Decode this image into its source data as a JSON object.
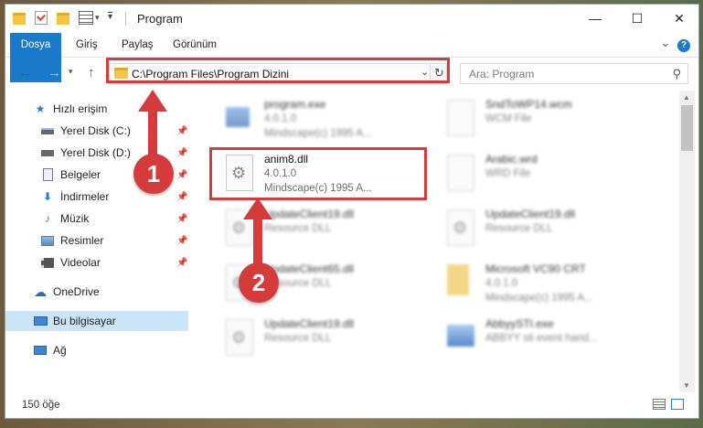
{
  "window": {
    "title": "Program",
    "controls": {
      "minimize": "—",
      "maximize": "☐",
      "close": "✕"
    }
  },
  "ribbon": {
    "tabs": [
      "Dosya",
      "Giriş",
      "Paylaş",
      "Görünüm"
    ],
    "expand": "⌄",
    "help": "?"
  },
  "nav": {
    "address": "C:\\Program Files\\Program Dizini",
    "search_placeholder": "Ara: Program"
  },
  "sidebar": {
    "items": [
      {
        "label": "Hızlı erişim",
        "icon": "star-icon"
      },
      {
        "label": "Yerel Disk (C:)",
        "icon": "drive-icon"
      },
      {
        "label": "Yerel Disk (D:)",
        "icon": "drive-icon"
      },
      {
        "label": "Belgeler",
        "icon": "documents-icon"
      },
      {
        "label": "İndirmeler",
        "icon": "download-icon"
      },
      {
        "label": "Müzik",
        "icon": "music-icon"
      },
      {
        "label": "Resimler",
        "icon": "pictures-icon"
      },
      {
        "label": "Videolar",
        "icon": "video-icon"
      },
      {
        "label": "OneDrive",
        "icon": "cloud-icon"
      },
      {
        "label": "Bu bilgisayar",
        "icon": "computer-icon"
      },
      {
        "label": "Ağ",
        "icon": "network-icon"
      }
    ]
  },
  "files": [
    {
      "name": "program.exe",
      "l2": "4.0.1.0",
      "l3": "Mindscape(c) 1995 A..."
    },
    {
      "name": "SndToWP14.wcm",
      "l2": "WCM File",
      "l3": ""
    },
    {
      "name": "anim8.dll",
      "l2": "4.0.1.0",
      "l3": "Mindscape(c) 1995 A..."
    },
    {
      "name": "Arabic.wrd",
      "l2": "WRD File",
      "l3": ""
    },
    {
      "name": "UpdateClient19.dll",
      "l2": "Resource DLL",
      "l3": ""
    },
    {
      "name": "UpdateClient19.dll",
      "l2": "Resource DLL",
      "l3": ""
    },
    {
      "name": "UpdateClient65.dll",
      "l2": "Resource DLL",
      "l3": ""
    },
    {
      "name": "Microsoft VC90 CRT",
      "l2": "4.0.1.0",
      "l3": "Mindscape(c) 1995 A..."
    },
    {
      "name": "UpdateClient19.dll",
      "l2": "Resource DLL",
      "l3": ""
    },
    {
      "name": "AbbyySTI.exe",
      "l2": "ABBYY sti event hand...",
      "l3": ""
    }
  ],
  "status": {
    "count": "150 öğe"
  },
  "annotations": {
    "badge1": "1",
    "badge2": "2",
    "color": "#d63b3b"
  }
}
